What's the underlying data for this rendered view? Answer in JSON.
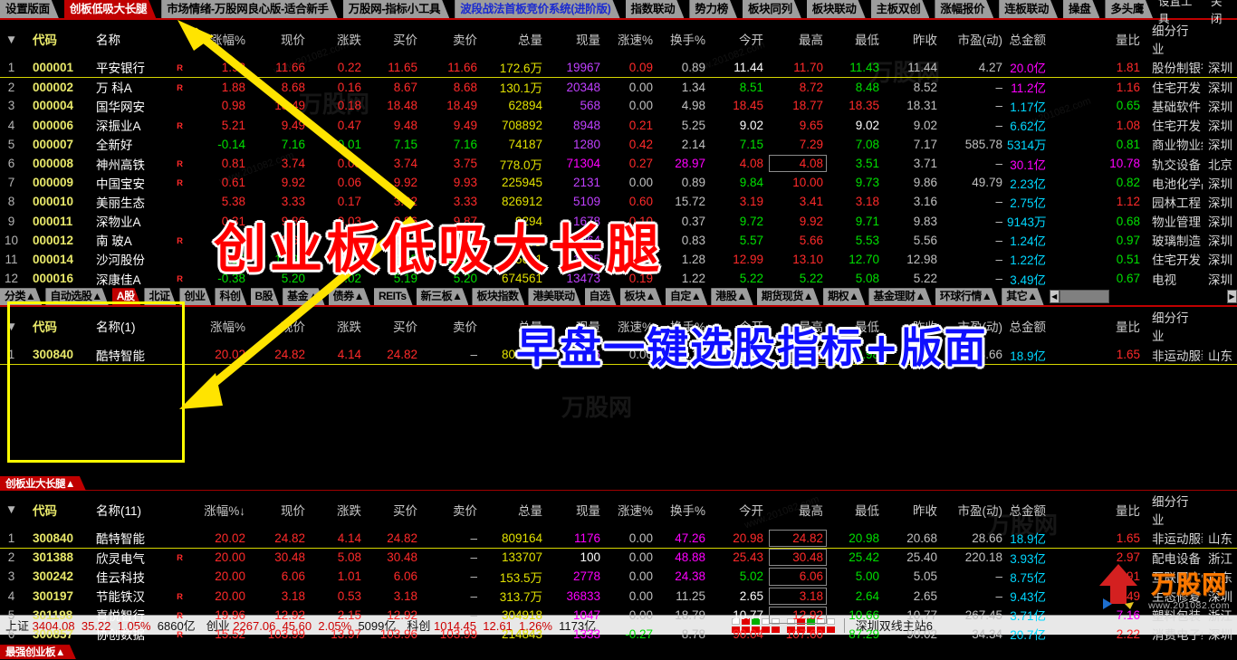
{
  "top_tabs": [
    {
      "label": "设置版面",
      "style": "grey"
    },
    {
      "label": "创板低吸大长腿",
      "style": "red"
    },
    {
      "label": "市场情绪-万股网良心版-适合新手",
      "style": "grey"
    },
    {
      "label": "万股网-指标小工具",
      "style": "grey"
    },
    {
      "label": "波段战法首板竞价系统(进阶版)",
      "style": "blue"
    },
    {
      "label": "指数联动",
      "style": "grey"
    },
    {
      "label": "势力榜",
      "style": "grey"
    },
    {
      "label": "板块同列",
      "style": "grey"
    },
    {
      "label": "板块联动",
      "style": "grey"
    },
    {
      "label": "主板双创",
      "style": "grey"
    },
    {
      "label": "涨幅报价",
      "style": "grey"
    },
    {
      "label": "连板联动",
      "style": "grey"
    },
    {
      "label": "操盘",
      "style": "grey"
    },
    {
      "label": "多头鹰",
      "style": "grey"
    }
  ],
  "top_tools": [
    "设置工具",
    "关闭"
  ],
  "columns": [
    "代码",
    "名称",
    "涨幅%",
    "现价",
    "涨跌",
    "买价",
    "卖价",
    "总量",
    "现量",
    "涨速%",
    "换手%",
    "今开",
    "最高",
    "最低",
    "昨收",
    "市盈(动)",
    "总金额",
    "量比",
    "细分行业",
    ""
  ],
  "columns_mid": [
    "代码",
    "名称(1)",
    "涨幅%",
    "现价",
    "涨跌",
    "买价",
    "卖价",
    "总量",
    "现量",
    "涨速%",
    "换手%",
    "今开",
    "最高",
    "最低",
    "昨收",
    "市盈(动)",
    "总金额",
    "量比",
    "细分行业",
    ""
  ],
  "columns_bot": [
    "代码",
    "名称(11)",
    "涨幅%↓",
    "现价",
    "涨跌",
    "买价",
    "卖价",
    "总量",
    "现量",
    "涨速%",
    "换手%",
    "今开",
    "最高",
    "最低",
    "昨收",
    "市盈(动)",
    "总金额",
    "量比",
    "细分行业",
    ""
  ],
  "table_main": {
    "rows": [
      {
        "idx": "1",
        "code": "000001",
        "name": "平安银行",
        "r": "R",
        "chg": "1.92",
        "price": "11.66",
        "delta": "0.22",
        "bid": "11.65",
        "ask": "11.66",
        "vol": "172.6万",
        "now": "19967",
        "speed": "0.09",
        "turn": "0.89",
        "open": "11.44",
        "high": "11.70",
        "low": "11.43",
        "prev": "11.44",
        "pe": "4.27",
        "amount": "20.0亿",
        "ratio": "1.81",
        "industry": "股份制银行",
        "region": "深圳",
        "dir": "up",
        "open_dir": "flat",
        "high_dir": "up",
        "low_dir": "dn",
        "speed_dir": "up",
        "amount_color": "mag",
        "high_box": false,
        "now_color": "vio"
      },
      {
        "idx": "2",
        "code": "000002",
        "name": "万 科A",
        "r": "R",
        "chg": "1.88",
        "price": "8.68",
        "delta": "0.16",
        "bid": "8.67",
        "ask": "8.68",
        "vol": "130.1万",
        "now": "20348",
        "speed": "0.00",
        "turn": "1.34",
        "open": "8.51",
        "high": "8.72",
        "low": "8.48",
        "prev": "8.52",
        "pe": "–",
        "amount": "11.2亿",
        "ratio": "1.16",
        "industry": "住宅开发",
        "region": "深圳",
        "dir": "up",
        "open_dir": "dn",
        "high_dir": "up",
        "low_dir": "dn",
        "speed_dir": "gry",
        "amount_color": "mag",
        "high_box": false,
        "now_color": "vio"
      },
      {
        "idx": "3",
        "code": "000004",
        "name": "国华网安",
        "r": "",
        "chg": "0.98",
        "price": "18.49",
        "delta": "0.18",
        "bid": "18.48",
        "ask": "18.49",
        "vol": "62894",
        "now": "568",
        "speed": "0.00",
        "turn": "4.98",
        "open": "18.45",
        "high": "18.77",
        "low": "18.35",
        "prev": "18.31",
        "pe": "–",
        "amount": "1.17亿",
        "ratio": "0.65",
        "industry": "基础软件",
        "region": "深圳",
        "dir": "up",
        "open_dir": "up",
        "high_dir": "up",
        "low_dir": "up",
        "speed_dir": "gry",
        "amount_color": "cyn",
        "high_box": false,
        "now_color": "vio"
      },
      {
        "idx": "4",
        "code": "000006",
        "name": "深振业A",
        "r": "R",
        "chg": "5.21",
        "price": "9.49",
        "delta": "0.47",
        "bid": "9.48",
        "ask": "9.49",
        "vol": "708892",
        "now": "8948",
        "speed": "0.21",
        "turn": "5.25",
        "open": "9.02",
        "high": "9.65",
        "low": "9.02",
        "prev": "9.02",
        "pe": "–",
        "amount": "6.62亿",
        "ratio": "1.08",
        "industry": "住宅开发",
        "region": "深圳",
        "dir": "up",
        "open_dir": "flat",
        "high_dir": "up",
        "low_dir": "flat",
        "speed_dir": "up",
        "amount_color": "cyn",
        "high_box": false,
        "now_color": "vio"
      },
      {
        "idx": "5",
        "code": "000007",
        "name": "全新好",
        "r": "",
        "chg": "-0.14",
        "price": "7.16",
        "delta": "-0.01",
        "bid": "7.15",
        "ask": "7.16",
        "vol": "74187",
        "now": "1280",
        "speed": "0.42",
        "turn": "2.14",
        "open": "7.15",
        "high": "7.29",
        "low": "7.08",
        "prev": "7.17",
        "pe": "585.78",
        "amount": "5314万",
        "ratio": "0.81",
        "industry": "商业物业经营",
        "region": "深圳",
        "dir": "dn",
        "open_dir": "dn",
        "high_dir": "up",
        "low_dir": "dn",
        "speed_dir": "up",
        "amount_color": "cyn",
        "high_box": false,
        "now_color": "vio"
      },
      {
        "idx": "6",
        "code": "000008",
        "name": "神州高铁",
        "r": "R",
        "chg": "0.81",
        "price": "3.74",
        "delta": "0.03",
        "bid": "3.74",
        "ask": "3.75",
        "vol": "778.0万",
        "now": "71304",
        "speed": "0.27",
        "turn": "28.97",
        "open": "4.08",
        "high": "4.08",
        "low": "3.51",
        "prev": "3.71",
        "pe": "–",
        "amount": "30.1亿",
        "ratio": "10.78",
        "industry": "轨交设备",
        "region": "北京",
        "dir": "up",
        "open_dir": "up",
        "high_dir": "up",
        "low_dir": "dn",
        "speed_dir": "up",
        "amount_color": "mag",
        "high_box": true,
        "now_color": "mag",
        "turn_color": "mag",
        "ratio_color": "mag"
      },
      {
        "idx": "7",
        "code": "000009",
        "name": "中国宝安",
        "r": "R",
        "chg": "0.61",
        "price": "9.92",
        "delta": "0.06",
        "bid": "9.92",
        "ask": "9.93",
        "vol": "225945",
        "now": "2131",
        "speed": "0.00",
        "turn": "0.89",
        "open": "9.84",
        "high": "10.00",
        "low": "9.73",
        "prev": "9.86",
        "pe": "49.79",
        "amount": "2.23亿",
        "ratio": "0.82",
        "industry": "电池化学品",
        "region": "深圳",
        "dir": "up",
        "open_dir": "dn",
        "high_dir": "up",
        "low_dir": "dn",
        "speed_dir": "gry",
        "amount_color": "cyn",
        "high_box": false,
        "now_color": "vio"
      },
      {
        "idx": "8",
        "code": "000010",
        "name": "美丽生态",
        "r": "",
        "chg": "5.38",
        "price": "3.33",
        "delta": "0.17",
        "bid": "3.32",
        "ask": "3.33",
        "vol": "826912",
        "now": "5109",
        "speed": "0.60",
        "turn": "15.72",
        "open": "3.19",
        "high": "3.41",
        "low": "3.18",
        "prev": "3.16",
        "pe": "–",
        "amount": "2.75亿",
        "ratio": "1.12",
        "industry": "园林工程",
        "region": "深圳",
        "dir": "up",
        "open_dir": "up",
        "high_dir": "up",
        "low_dir": "up",
        "speed_dir": "up",
        "amount_color": "cyn",
        "high_box": false,
        "now_color": "vio"
      },
      {
        "idx": "9",
        "code": "000011",
        "name": "深物业A",
        "r": "",
        "chg": "0.31",
        "price": "9.86",
        "delta": "0.03",
        "bid": "9.86",
        "ask": "9.87",
        "vol": "9294",
        "now": "1678",
        "speed": "0.10",
        "turn": "0.37",
        "open": "9.72",
        "high": "9.92",
        "low": "9.71",
        "prev": "9.83",
        "pe": "–",
        "amount": "9143万",
        "ratio": "0.68",
        "industry": "物业管理",
        "region": "深圳",
        "dir": "up",
        "open_dir": "dn",
        "high_dir": "up",
        "low_dir": "dn",
        "speed_dir": "up",
        "amount_color": "cyn",
        "high_box": false,
        "now_color": "vio"
      },
      {
        "idx": "10",
        "code": "000012",
        "name": "南 玻A",
        "r": "R",
        "chg": "1.26",
        "price": "5.63",
        "delta": "0.07",
        "bid": "5.62",
        "ask": "5.63",
        "vol": "172.1万",
        "now": "3064",
        "speed": "0.00",
        "turn": "0.83",
        "open": "5.57",
        "high": "5.66",
        "low": "5.53",
        "prev": "5.56",
        "pe": "–",
        "amount": "1.24亿",
        "ratio": "0.97",
        "industry": "玻璃制造",
        "region": "深圳",
        "dir": "up",
        "open_dir": "dn",
        "high_dir": "up",
        "low_dir": "dn",
        "speed_dir": "gry",
        "amount_color": "cyn",
        "high_box": false,
        "now_color": "vio"
      },
      {
        "idx": "11",
        "code": "000014",
        "name": "沙河股份",
        "r": "",
        "chg": "-0.15",
        "price": "12.96",
        "delta": "-0.02",
        "bid": "12.95",
        "ask": "12.96",
        "vol": "95681",
        "now": "1435",
        "speed": "0.00",
        "turn": "1.28",
        "open": "12.99",
        "high": "13.10",
        "low": "12.70",
        "prev": "12.98",
        "pe": "–",
        "amount": "1.22亿",
        "ratio": "0.51",
        "industry": "住宅开发",
        "region": "深圳",
        "dir": "dn",
        "open_dir": "up",
        "high_dir": "up",
        "low_dir": "dn",
        "speed_dir": "gry",
        "amount_color": "cyn",
        "high_box": false,
        "now_color": "vio"
      },
      {
        "idx": "12",
        "code": "000016",
        "name": "深康佳A",
        "r": "R",
        "chg": "-0.38",
        "price": "5.20",
        "delta": "-0.02",
        "bid": "5.19",
        "ask": "5.20",
        "vol": "674561",
        "now": "13473",
        "speed": "0.19",
        "turn": "1.22",
        "open": "5.22",
        "high": "5.22",
        "low": "5.08",
        "prev": "5.22",
        "pe": "–",
        "amount": "3.49亿",
        "ratio": "0.67",
        "industry": "电视",
        "region": "深圳",
        "dir": "dn",
        "open_dir": "dn",
        "high_dir": "dn",
        "low_dir": "dn",
        "speed_dir": "up",
        "amount_color": "cyn",
        "high_box": false,
        "now_color": "vio"
      }
    ]
  },
  "section_tabs_left": [
    {
      "label": "分类▲",
      "style": "grey"
    },
    {
      "label": "自动选股▲",
      "style": "grey"
    },
    {
      "label": "A股",
      "style": "red"
    },
    {
      "label": "北证",
      "style": "grey"
    },
    {
      "label": "创业",
      "style": "grey"
    },
    {
      "label": "科创",
      "style": "grey"
    },
    {
      "label": "B股",
      "style": "grey"
    },
    {
      "label": "基金▲",
      "style": "grey"
    },
    {
      "label": "债券▲",
      "style": "grey"
    },
    {
      "label": "REITs",
      "style": "grey"
    },
    {
      "label": "新三板▲",
      "style": "grey"
    },
    {
      "label": "板块指数",
      "style": "grey"
    },
    {
      "label": "港美联动",
      "style": "grey"
    },
    {
      "label": "自选",
      "style": "grey"
    },
    {
      "label": "板块▲",
      "style": "grey"
    },
    {
      "label": "自定▲",
      "style": "grey"
    },
    {
      "label": "港股▲",
      "style": "grey"
    },
    {
      "label": "期货现货▲",
      "style": "grey"
    },
    {
      "label": "期权▲",
      "style": "grey"
    },
    {
      "label": "基金理财▲",
      "style": "grey"
    },
    {
      "label": "环球行情▲",
      "style": "grey"
    },
    {
      "label": "其它▲",
      "style": "grey"
    }
  ],
  "mid_panel": {
    "rows": [
      {
        "idx": "1",
        "code": "300840",
        "name": "酷特智能",
        "r": "",
        "chg": "20.02",
        "price": "24.82",
        "delta": "4.14",
        "bid": "24.82",
        "ask": "–",
        "vol": "809160",
        "now": "1176",
        "speed": "0.00",
        "turn": "47.26",
        "open": "20.98",
        "high": "24.82",
        "low": "20.98",
        "prev": "20.68",
        "pe": "28.66",
        "amount": "18.9亿",
        "ratio": "1.65",
        "industry": "非运动服装",
        "region": "山东",
        "dir": "up",
        "high_box": true
      }
    ]
  },
  "bot_group_label": "创板业大长腿▲",
  "bot_panel": {
    "rows": [
      {
        "idx": "1",
        "code": "300840",
        "name": "酷特智能",
        "r": "",
        "chg": "20.02",
        "price": "24.82",
        "delta": "4.14",
        "bid": "24.82",
        "ask": "–",
        "vol": "809164",
        "now": "1176",
        "speed": "0.00",
        "turn": "47.26",
        "open": "20.98",
        "high": "24.82",
        "low": "20.98",
        "prev": "20.68",
        "pe": "28.66",
        "amount": "18.9亿",
        "ratio": "1.65",
        "industry": "非运动服装",
        "region": "山东",
        "dir": "up",
        "open_dir": "up",
        "high_box": true,
        "now_color": "mag",
        "turn_color": "mag",
        "speed_dir": "gry"
      },
      {
        "idx": "2",
        "code": "301388",
        "name": "欣灵电气",
        "r": "R",
        "chg": "20.00",
        "price": "30.48",
        "delta": "5.08",
        "bid": "30.48",
        "ask": "–",
        "vol": "133707",
        "now": "100",
        "speed": "0.00",
        "turn": "48.88",
        "open": "25.43",
        "high": "30.48",
        "low": "25.42",
        "prev": "25.40",
        "pe": "220.18",
        "amount": "3.93亿",
        "ratio": "2.97",
        "industry": "配电设备",
        "region": "浙江",
        "dir": "up",
        "open_dir": "up",
        "high_box": true,
        "now_color": "fl",
        "turn_color": "mag",
        "speed_dir": "gry"
      },
      {
        "idx": "3",
        "code": "300242",
        "name": "佳云科技",
        "r": "",
        "chg": "20.00",
        "price": "6.06",
        "delta": "1.01",
        "bid": "6.06",
        "ask": "–",
        "vol": "153.5万",
        "now": "2778",
        "speed": "0.00",
        "turn": "24.38",
        "open": "5.02",
        "high": "6.06",
        "low": "5.00",
        "prev": "5.05",
        "pe": "–",
        "amount": "8.75亿",
        "ratio": "1.91",
        "industry": "互联网广告",
        "region": "广东",
        "dir": "up",
        "open_dir": "dn",
        "high_box": true,
        "now_color": "mag",
        "turn_color": "mag",
        "speed_dir": "gry"
      },
      {
        "idx": "4",
        "code": "300197",
        "name": "节能铁汉",
        "r": "R",
        "chg": "20.00",
        "price": "3.18",
        "delta": "0.53",
        "bid": "3.18",
        "ask": "–",
        "vol": "313.7万",
        "now": "36833",
        "speed": "0.00",
        "turn": "11.25",
        "open": "2.65",
        "high": "3.18",
        "low": "2.64",
        "prev": "2.65",
        "pe": "–",
        "amount": "9.43亿",
        "ratio": "2.49",
        "industry": "生态修复",
        "region": "深圳",
        "dir": "up",
        "open_dir": "flat",
        "high_box": true,
        "now_color": "mag",
        "turn_color": "gry",
        "speed_dir": "gry"
      },
      {
        "idx": "5",
        "code": "301198",
        "name": "喜悦智行",
        "r": "R",
        "chg": "19.96",
        "price": "12.92",
        "delta": "2.15",
        "bid": "12.92",
        "ask": "–",
        "vol": "304918",
        "now": "1047",
        "speed": "0.00",
        "turn": "18.79",
        "open": "10.77",
        "high": "12.92",
        "low": "10.66",
        "prev": "10.77",
        "pe": "267.45",
        "amount": "3.71亿",
        "ratio": "7.16",
        "industry": "塑料包装",
        "region": "浙江",
        "dir": "up",
        "open_dir": "flat",
        "high_box": true,
        "now_color": "mag",
        "turn_color": "gry",
        "speed_dir": "gry",
        "ratio_color": "mag"
      },
      {
        "idx": "6",
        "code": "300857",
        "name": "协创数据",
        "r": "R",
        "chg": "15.52",
        "price": "103.99",
        "delta": "13.97",
        "bid": "103.96",
        "ask": "103.99",
        "vol": "214843",
        "now": "1333",
        "speed": "-0.27",
        "turn": "8.78",
        "open": "90.04",
        "high": "107.60",
        "low": "87.29",
        "prev": "90.02",
        "pe": "34.34",
        "amount": "20.7亿",
        "ratio": "2.22",
        "industry": "消费电子组件",
        "region": "深圳",
        "dir": "up",
        "open_dir": "up",
        "high_box": false,
        "now_color": "mag",
        "turn_color": "gry",
        "speed_dir": "dn"
      }
    ]
  },
  "bottom_group_label": "最强创业板▲",
  "overlays": {
    "red_text": "创业板低吸大长腿",
    "blue_text": "早盘一键选股指标+版面"
  },
  "status": {
    "items": [
      {
        "label": "上证",
        "value": "3404.08",
        "delta": "35.22",
        "pct": "1.05%",
        "amount": "6860亿"
      },
      {
        "label": "创业",
        "value": "2267.06",
        "delta": "45.60",
        "pct": "2.05%",
        "amount": "5099亿"
      },
      {
        "label": "科创",
        "value": "1014.45",
        "delta": "12.61",
        "pct": "1.26%",
        "amount": "1173亿"
      }
    ],
    "server": "深圳双线主站6"
  },
  "brand": {
    "name": "万股网",
    "url": "www.201082.com"
  },
  "colors": {
    "up": "#ff2a2a",
    "down": "#00e000",
    "flat": "#ffffff",
    "accent_red": "#c00000",
    "highlight_yellow": "#ffff00",
    "tab_grey": "#9d9d9d",
    "code_yellow": "#e8e86a"
  }
}
